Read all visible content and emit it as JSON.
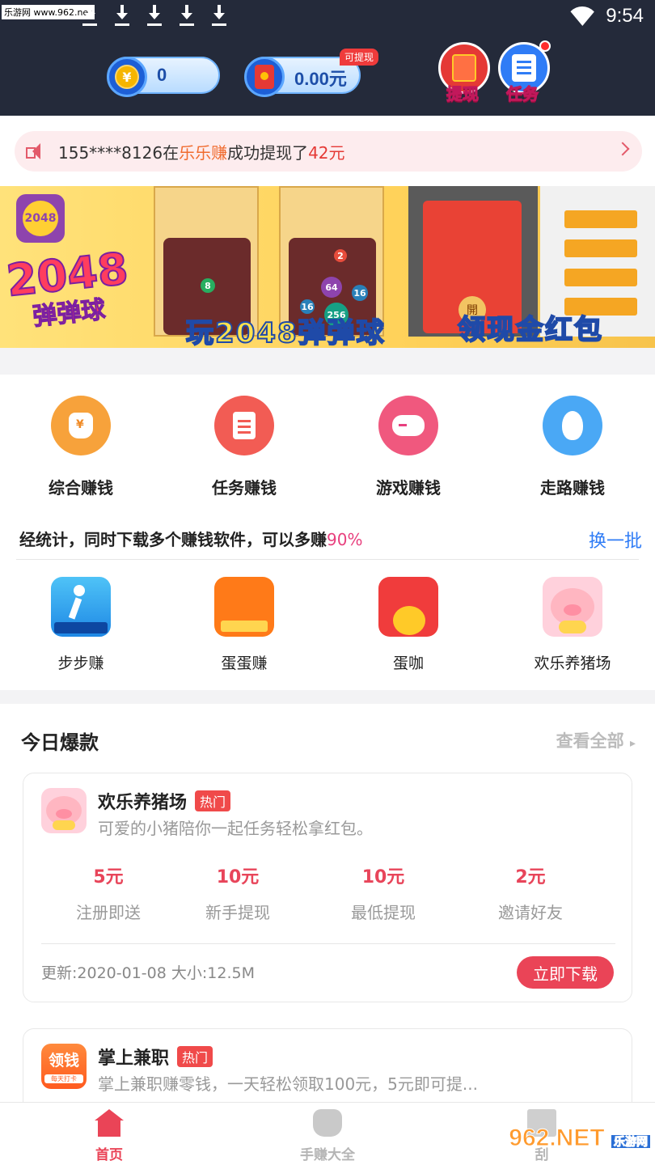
{
  "status_bar": {
    "watermark": "乐游网 www.962.net",
    "time": "9:54",
    "icons": [
      "download-icon",
      "download-icon",
      "download-icon",
      "download-icon",
      "download-icon",
      "wifi-icon"
    ]
  },
  "header": {
    "coins_value": "0",
    "cash_value": "0.00元",
    "withdrawable_badge": "可提现",
    "withdraw_label": "提现",
    "task_label": "任务"
  },
  "notice": {
    "prefix": "155****8126在",
    "app_name": "乐乐赚",
    "middle": "成功提现了",
    "amount": "42元"
  },
  "banner": {
    "logo_text": "2048",
    "title": "2048",
    "subtitle": "弹弹球",
    "cta_left": "玩2048弹弹球",
    "cta_right": "领现金红包",
    "open_label": "開"
  },
  "categories": [
    {
      "label": "综合赚钱",
      "icon": "money-bag-icon",
      "color": "#f7a23b"
    },
    {
      "label": "任务赚钱",
      "icon": "clipboard-icon",
      "color": "#f25c54"
    },
    {
      "label": "游戏赚钱",
      "icon": "gamepad-icon",
      "color": "#f0587e"
    },
    {
      "label": "走路赚钱",
      "icon": "footprint-icon",
      "color": "#4aa8f5"
    }
  ],
  "stats": {
    "text": "经统计，同时下载多个赚钱软件，可以多赚",
    "percent": "90%",
    "refresh": "换一批"
  },
  "apps": [
    {
      "label": "步步赚",
      "icon": "walking-person-icon"
    },
    {
      "label": "蛋蛋赚",
      "icon": "egg-app-icon"
    },
    {
      "label": "蛋咖",
      "icon": "egg-chick-icon"
    },
    {
      "label": "欢乐养猪场",
      "icon": "pig-icon"
    }
  ],
  "hot": {
    "title": "今日爆款",
    "see_all": "查看全部",
    "card1": {
      "name": "欢乐养猪场",
      "tag": "热门",
      "desc": "可爱的小猪陪你一起任务轻松拿红包。",
      "metrics": [
        {
          "value": "5元",
          "label": "注册即送"
        },
        {
          "value": "10元",
          "label": "新手提现"
        },
        {
          "value": "10元",
          "label": "最低提现"
        },
        {
          "value": "2元",
          "label": "邀请好友"
        }
      ],
      "meta": "更新:2020-01-08  大小:12.5M",
      "download": "立即下载"
    },
    "card2": {
      "name": "掌上兼职",
      "tag": "热门",
      "desc": "掌上兼职赚零钱，一天轻松领取100元，5元即可提...",
      "icon_text": "领钱",
      "icon_sub": "每天打卡"
    }
  },
  "bottom_nav": [
    {
      "label": "首页",
      "icon": "home-icon",
      "active": true
    },
    {
      "label": "手赚大全",
      "icon": "money-bag-icon",
      "active": false
    },
    {
      "label": "刮",
      "icon": "gift-icon",
      "active": false
    }
  ],
  "corner_watermark": {
    "text": "962.NET",
    "sub": "乐游网"
  },
  "colors": {
    "accent": "#ea4457",
    "header_bg": "#242a3a",
    "link": "#2f7cf6"
  }
}
